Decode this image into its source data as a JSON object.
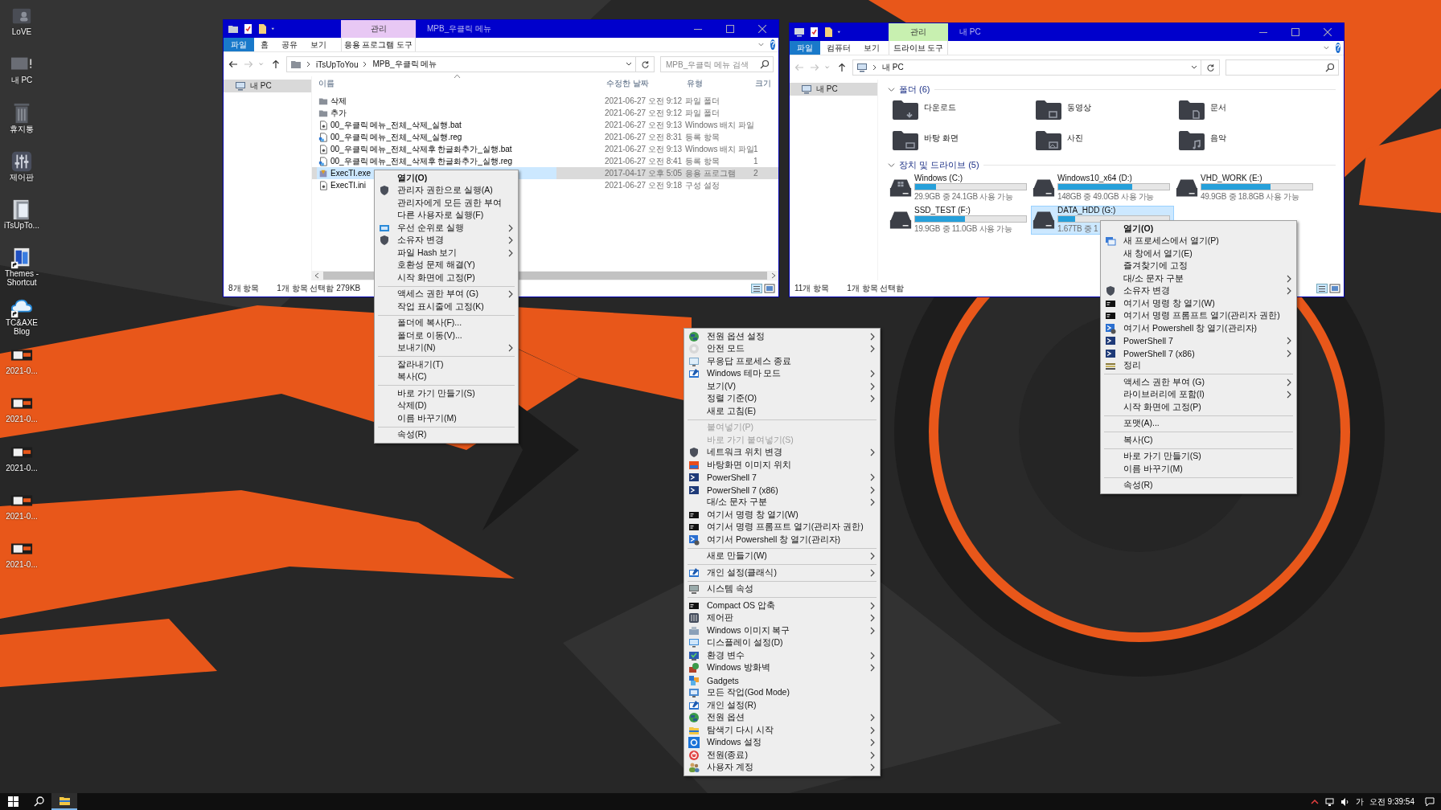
{
  "desktop_icons": [
    {
      "label": "LoVE",
      "kind": "user",
      "shortcut": false
    },
    {
      "label": "내 PC",
      "kind": "pc",
      "shortcut": false
    },
    {
      "label": "휴지통",
      "kind": "trash",
      "shortcut": false
    },
    {
      "label": "제어판",
      "kind": "control",
      "shortcut": false
    },
    {
      "label": "iTsUpTo...",
      "kind": "folder",
      "shortcut": false
    },
    {
      "label": "Themes - Shortcut",
      "kind": "themes",
      "shortcut": true
    },
    {
      "label": "TC&AXE Blog",
      "kind": "cloud",
      "shortcut": true
    },
    {
      "label": "2021-0...",
      "kind": "thumb",
      "shortcut": false
    },
    {
      "label": "2021-0...",
      "kind": "thumb",
      "shortcut": false
    },
    {
      "label": "2021-0...",
      "kind": "thumb",
      "shortcut": false
    },
    {
      "label": "2021-0...",
      "kind": "thumb",
      "shortcut": false
    },
    {
      "label": "2021-0...",
      "kind": "thumb",
      "shortcut": false
    }
  ],
  "windows": [
    {
      "kind": "files",
      "title": "MPB_우클릭 메뉴",
      "context_tab": "관리",
      "tool_tab": "응용 프로그램 도구",
      "tabs": [
        "파일",
        "홈",
        "공유",
        "보기"
      ],
      "help": "?",
      "back_enabled": true,
      "forward_enabled": false,
      "path": [
        "iTsUpToYou",
        "MPB_우클릭 메뉴"
      ],
      "search_placeholder": "MPB_우클릭 메뉴 검색",
      "nav": [
        {
          "label": "내 PC",
          "selected": true
        }
      ],
      "columns": [
        "이름",
        "수정한 날짜",
        "유형",
        "크기"
      ],
      "rows": [
        {
          "kind": "folder",
          "name": "삭제",
          "date": "2021-06-27 오전 9:12",
          "type": "파일 폴더",
          "selected": false
        },
        {
          "kind": "folder",
          "name": "추가",
          "date": "2021-06-27 오전 9:12",
          "type": "파일 폴더",
          "selected": false
        },
        {
          "kind": "bat",
          "name": "00_우클릭 메뉴_전체_삭제_실행.bat",
          "date": "2021-06-27 오전 9:13",
          "type": "Windows 배치 파일",
          "selected": false
        },
        {
          "kind": "reg",
          "name": "00_우클릭 메뉴_전체_삭제_실행.reg",
          "date": "2021-06-27 오전 8:31",
          "type": "등록 항목",
          "selected": false
        },
        {
          "kind": "bat",
          "name": "00_우클릭 메뉴_전체_삭제후 한글화추가_실행.bat",
          "date": "2021-06-27 오전 9:13",
          "type": "Windows 배치 파일",
          "size": "1",
          "selected": false
        },
        {
          "kind": "reg",
          "name": "00_우클릭 메뉴_전체_삭제후 한글화추가_실행.reg",
          "date": "2021-06-27 오전 8:41",
          "type": "등록 항목",
          "size": "1",
          "selected": false
        },
        {
          "kind": "exe",
          "name": "ExecTI.exe",
          "date": "2017-04-17 오후 5:05",
          "type": "응용 프로그램",
          "size": "2",
          "selected": true
        },
        {
          "kind": "ini",
          "name": "ExecTI.ini",
          "date": "2021-06-27 오전 9:18",
          "type": "구성 설정",
          "selected": false
        }
      ],
      "status": [
        "8개 항목",
        "1개 항목 선택함 279KB"
      ]
    },
    {
      "kind": "pc",
      "title": "내 PC",
      "context_tab": "관리",
      "tool_tab": "드라이브 도구",
      "tabs": [
        "파일",
        "컴퓨터",
        "보기"
      ],
      "help": "?",
      "back_enabled": false,
      "forward_enabled": false,
      "path": [
        "내 PC"
      ],
      "nav": [
        {
          "label": "내 PC",
          "selected": true
        }
      ],
      "groups": [
        {
          "kind": "folders",
          "title": "폴더 (6)",
          "expanded": true,
          "items": [
            {
              "kind": "download",
              "label": "다운로드"
            },
            {
              "kind": "video",
              "label": "동영상"
            },
            {
              "kind": "document",
              "label": "문서"
            },
            {
              "kind": "desktop",
              "label": "바탕 화면"
            },
            {
              "kind": "pictures",
              "label": "사진"
            },
            {
              "kind": "music",
              "label": "음악"
            }
          ]
        },
        {
          "kind": "drives",
          "title": "장치 및 드라이브 (5)",
          "expanded": true,
          "items": [
            {
              "kind": "system",
              "label": "Windows (C:)",
              "level": 0.19,
              "space": "29.9GB 중 24.1GB 사용 가능",
              "selected": false
            },
            {
              "kind": "disk",
              "label": "Windows10_x64 (D:)",
              "level": 0.67,
              "space": "148GB 중 49.0GB 사용 가능",
              "selected": false
            },
            {
              "kind": "disk",
              "label": "VHD_WORK (E:)",
              "level": 0.62,
              "space": "49.9GB 중 18.8GB 사용 가능",
              "selected": false
            },
            {
              "kind": "disk",
              "label": "SSD_TEST (F:)",
              "level": 0.45,
              "space": "19.9GB 중 11.0GB 사용 가능",
              "selected": false
            },
            {
              "kind": "disk",
              "label": "DATA_HDD (G:)",
              "level": 0.15,
              "space": "1.67TB 중 1",
              "selected": true
            }
          ]
        }
      ],
      "status": [
        "11개 항목",
        "1개 항목 선택함"
      ]
    }
  ],
  "context_menus": [
    {
      "items": [
        {
          "kind": "default",
          "label": "열기(O)",
          "submenu": false
        },
        {
          "kind": "item",
          "label": "관리자 권한으로 실행(A)",
          "submenu": false
        },
        {
          "kind": "item",
          "label": "관리자에게 모든 권한 부여",
          "submenu": false
        },
        {
          "kind": "item",
          "label": "다른 사용자로 실행(F)",
          "submenu": false
        },
        {
          "kind": "item",
          "label": "우선 순위로 실행",
          "submenu": true
        },
        {
          "kind": "item",
          "label": "소유자 변경",
          "submenu": true
        },
        {
          "kind": "item",
          "label": "파일 Hash 보기",
          "submenu": true
        },
        {
          "kind": "item",
          "label": "호환성 문제 해결(Y)",
          "submenu": false
        },
        {
          "kind": "item",
          "label": "시작 화면에 고정(P)",
          "submenu": false
        },
        {
          "kind": "separator"
        },
        {
          "kind": "item",
          "label": "액세스 권한 부여 (G)",
          "submenu": true
        },
        {
          "kind": "item",
          "label": "작업 표시줄에 고정(K)",
          "submenu": false
        },
        {
          "kind": "separator"
        },
        {
          "kind": "item",
          "label": "폴더에 복사(F)...",
          "submenu": false
        },
        {
          "kind": "item",
          "label": "폴더로 이동(V)...",
          "submenu": false
        },
        {
          "kind": "item",
          "label": "보내기(N)",
          "submenu": true
        },
        {
          "kind": "separator"
        },
        {
          "kind": "item",
          "label": "잘라내기(T)",
          "submenu": false
        },
        {
          "kind": "item",
          "label": "복사(C)",
          "submenu": false
        },
        {
          "kind": "separator"
        },
        {
          "kind": "item",
          "label": "바로 가기 만들기(S)",
          "submenu": false
        },
        {
          "kind": "item",
          "label": "삭제(D)",
          "submenu": false
        },
        {
          "kind": "item",
          "label": "이름 바꾸기(M)",
          "submenu": false
        },
        {
          "kind": "separator"
        },
        {
          "kind": "item",
          "label": "속성(R)",
          "submenu": false
        }
      ]
    },
    {
      "items": [
        {
          "kind": "default",
          "label": "열기(O)",
          "submenu": false
        },
        {
          "kind": "item",
          "label": "새 프로세스에서 열기(P)",
          "submenu": false
        },
        {
          "kind": "item",
          "label": "새 창에서 열기(E)",
          "submenu": false
        },
        {
          "kind": "item",
          "label": "즐겨찾기에 고정",
          "submenu": false
        },
        {
          "kind": "item",
          "label": "대/소 문자 구분",
          "submenu": true
        },
        {
          "kind": "item",
          "label": "소유자 변경",
          "submenu": true
        },
        {
          "kind": "item",
          "label": "여기서 명령 창 열기(W)",
          "submenu": false
        },
        {
          "kind": "item",
          "label": "여기서 명령 프롬프트 열기(관리자 권한)",
          "submenu": false
        },
        {
          "kind": "item",
          "label": "여기서 Powershell 창 열기(관리자)",
          "submenu": false
        },
        {
          "kind": "item",
          "label": "PowerShell 7",
          "submenu": true
        },
        {
          "kind": "item",
          "label": "PowerShell 7 (x86)",
          "submenu": true
        },
        {
          "kind": "item",
          "label": "정리",
          "submenu": false
        },
        {
          "kind": "separator"
        },
        {
          "kind": "item",
          "label": "액세스 권한 부여 (G)",
          "submenu": true
        },
        {
          "kind": "item",
          "label": "라이브러리에 포함(I)",
          "submenu": true
        },
        {
          "kind": "item",
          "label": "시작 화면에 고정(P)",
          "submenu": false
        },
        {
          "kind": "separator"
        },
        {
          "kind": "item",
          "label": "포맷(A)...",
          "submenu": false
        },
        {
          "kind": "separator"
        },
        {
          "kind": "item",
          "label": "복사(C)",
          "submenu": false
        },
        {
          "kind": "separator"
        },
        {
          "kind": "item",
          "label": "바로 가기 만들기(S)",
          "submenu": false
        },
        {
          "kind": "item",
          "label": "이름 바꾸기(M)",
          "submenu": false
        },
        {
          "kind": "separator"
        },
        {
          "kind": "item",
          "label": "속성(R)",
          "submenu": false
        }
      ]
    },
    {
      "items": [
        {
          "kind": "item",
          "label": "전원 옵션 설정",
          "submenu": true
        },
        {
          "kind": "item",
          "label": "안전 모드",
          "submenu": true
        },
        {
          "kind": "item",
          "label": "무응답 프로세스 종료",
          "submenu": false
        },
        {
          "kind": "item",
          "label": "Windows 테마 모드",
          "submenu": true
        },
        {
          "kind": "item",
          "label": "보기(V)",
          "submenu": true
        },
        {
          "kind": "item",
          "label": "정렬 기준(O)",
          "submenu": true
        },
        {
          "kind": "item",
          "label": "새로 고침(E)",
          "submenu": false
        },
        {
          "kind": "separator"
        },
        {
          "kind": "disabled",
          "label": "붙여넣기(P)",
          "submenu": false
        },
        {
          "kind": "disabled",
          "label": "바로 가기 붙여넣기(S)",
          "submenu": false
        },
        {
          "kind": "item",
          "label": "네트워크 위치 변경",
          "submenu": true
        },
        {
          "kind": "item",
          "label": "바탕화면 이미지 위치",
          "submenu": false
        },
        {
          "kind": "item",
          "label": "PowerShell 7",
          "submenu": true
        },
        {
          "kind": "item",
          "label": "PowerShell 7 (x86)",
          "submenu": true
        },
        {
          "kind": "item",
          "label": "대/소 문자 구분",
          "submenu": true
        },
        {
          "kind": "item",
          "label": "여기서 명령 창 열기(W)",
          "submenu": false
        },
        {
          "kind": "item",
          "label": "여기서 명령 프롬프트 열기(관리자 권한)",
          "submenu": false
        },
        {
          "kind": "item",
          "label": "여기서 Powershell 창 열기(관리자)",
          "submenu": false
        },
        {
          "kind": "separator"
        },
        {
          "kind": "item",
          "label": "새로 만들기(W)",
          "submenu": true
        },
        {
          "kind": "separator"
        },
        {
          "kind": "item",
          "label": "개인 설정(클래식)",
          "submenu": true
        },
        {
          "kind": "separator"
        },
        {
          "kind": "item",
          "label": "시스템 속성",
          "submenu": false
        },
        {
          "kind": "separator"
        },
        {
          "kind": "item",
          "label": "Compact OS 압축",
          "submenu": true
        },
        {
          "kind": "item",
          "label": "제어판",
          "submenu": true
        },
        {
          "kind": "item",
          "label": "Windows 이미지 복구",
          "submenu": true
        },
        {
          "kind": "item",
          "label": "디스플레이 설정(D)",
          "submenu": false
        },
        {
          "kind": "item",
          "label": "환경 변수",
          "submenu": true
        },
        {
          "kind": "item",
          "label": "Windows 방화벽",
          "submenu": true
        },
        {
          "kind": "item",
          "label": "Gadgets",
          "submenu": false
        },
        {
          "kind": "item",
          "label": "모든 작업(God Mode)",
          "submenu": false
        },
        {
          "kind": "item",
          "label": "개인 설정(R)",
          "submenu": false
        },
        {
          "kind": "item",
          "label": "전원 옵션",
          "submenu": true
        },
        {
          "kind": "item",
          "label": "탐색기 다시 시작",
          "submenu": true
        },
        {
          "kind": "item",
          "label": "Windows 설정",
          "submenu": true
        },
        {
          "kind": "item",
          "label": "전원(종료)",
          "submenu": true
        },
        {
          "kind": "item",
          "label": "사용자 계정",
          "submenu": true
        }
      ]
    }
  ],
  "taskbar": {
    "input_indicator": "가",
    "clock": "오전 9:39:54"
  }
}
